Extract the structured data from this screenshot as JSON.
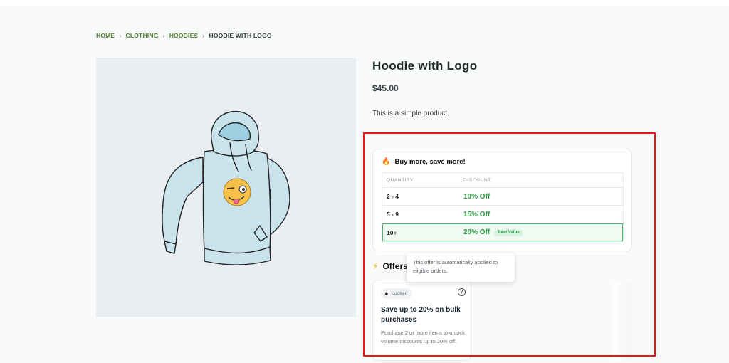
{
  "breadcrumb": {
    "items": [
      "HOME",
      "CLOTHING",
      "HOODIES"
    ],
    "separator": "›",
    "current": "HOODIE WITH LOGO"
  },
  "product": {
    "title": "Hoodie with Logo",
    "price": "$45.00",
    "description": "This is a simple product."
  },
  "tiers": {
    "heading": "Buy more, save more!",
    "icon": "fire-icon",
    "columns": [
      "QUANTITY",
      "DISCOUNT"
    ],
    "rows": [
      {
        "qty": "2 - 4",
        "discount": "10% Off"
      },
      {
        "qty": "5 - 9",
        "discount": "15% Off"
      },
      {
        "qty": "10+",
        "discount": "20% Off",
        "badge": "Best Value"
      }
    ]
  },
  "offers": {
    "heading": "Offers",
    "icon": "lightning-icon",
    "tooltip": "This offer is automatically applied to eligible orders.",
    "card": {
      "status": "Locked",
      "help_icon": "?",
      "title": "Save up to 20% on bulk purchases",
      "description": "Purchase 2 or more items to unlock volume discounts up to 20% off."
    }
  },
  "colors": {
    "accent_green": "#2d9c45",
    "breadcrumb_link": "#4d7c2f",
    "highlight_border": "#f01414"
  }
}
